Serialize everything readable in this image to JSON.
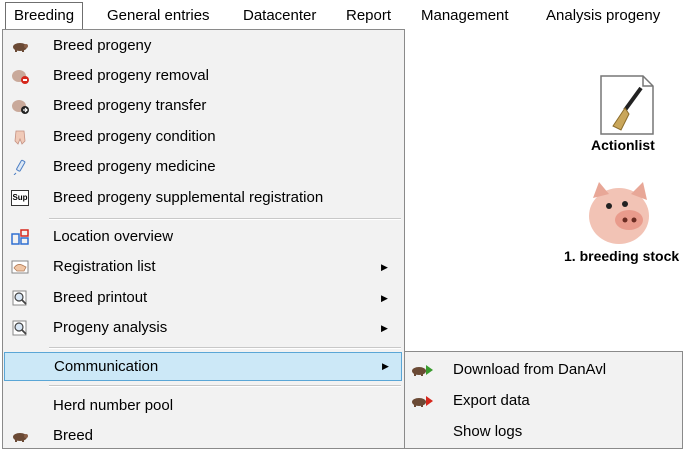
{
  "menubar": {
    "items": [
      {
        "label": "Breeding"
      },
      {
        "label": "General entries"
      },
      {
        "label": "Datacenter"
      },
      {
        "label": "Report"
      },
      {
        "label": "Management"
      },
      {
        "label": "Analysis progeny"
      }
    ]
  },
  "breeding_menu": {
    "items": [
      {
        "label": "Breed progeny",
        "icon": "pig-icon"
      },
      {
        "label": "Breed progeny removal",
        "icon": "pig-remove-icon"
      },
      {
        "label": "Breed progeny transfer",
        "icon": "pig-transfer-icon"
      },
      {
        "label": "Breed progeny condition",
        "icon": "hoof-icon"
      },
      {
        "label": "Breed progeny medicine",
        "icon": "syringe-icon"
      },
      {
        "label": "Breed progeny supplemental registration",
        "icon": "sup-icon",
        "icon_text": "Sup"
      },
      {
        "label": "Location overview",
        "icon": "location-grid-icon"
      },
      {
        "label": "Registration list",
        "icon": "hand-icon",
        "submenu": true
      },
      {
        "label": "Breed printout",
        "icon": "magnifier-report-icon",
        "submenu": true
      },
      {
        "label": "Progeny analysis",
        "icon": "magnifier-report-icon",
        "submenu": true
      },
      {
        "label": "Communication",
        "submenu": true,
        "highlighted": true
      },
      {
        "label": "Herd number pool"
      },
      {
        "label": "Breed",
        "icon": "pig-icon"
      }
    ]
  },
  "communication_submenu": {
    "items": [
      {
        "label": "Download from DanAvl",
        "icon": "pig-download-icon"
      },
      {
        "label": "Export data",
        "icon": "pig-export-icon"
      },
      {
        "label": "Show logs"
      }
    ]
  },
  "desktop": {
    "actionlist_label": "Actionlist",
    "breeding_stock_label": "1. breeding stock"
  },
  "colors": {
    "highlight_bg": "#cce8f7",
    "highlight_border": "#5aa6d6",
    "menu_bg": "#f2f2f2"
  }
}
